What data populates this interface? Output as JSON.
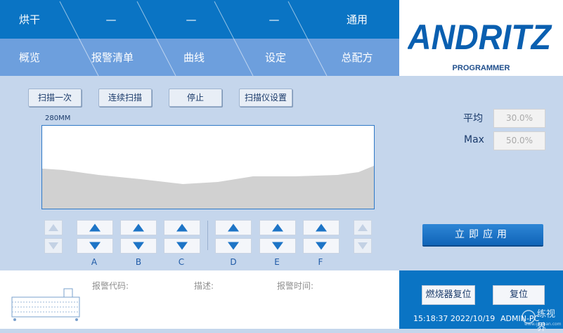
{
  "nav": {
    "row1": [
      "烘干",
      "—",
      "—",
      "—",
      "通用"
    ],
    "row2": [
      "概览",
      "报警清单",
      "曲线",
      "设定",
      "总配方"
    ]
  },
  "logo": {
    "brand": "ANDRITZ",
    "subtitle": "PROGRAMMER"
  },
  "scan_buttons": [
    "扫描一次",
    "连续扫描",
    "停止",
    "扫描仪设置"
  ],
  "chart": {
    "label": "280MM"
  },
  "stats": {
    "avg_label": "平均",
    "avg_value": "30.0%",
    "max_label": "Max",
    "max_value": "50.0%"
  },
  "channels": [
    "A",
    "B",
    "C",
    "D",
    "E",
    "F"
  ],
  "apply_label": "立即应用",
  "alarm": {
    "code_label": "报警代码:",
    "desc_label": "描述:",
    "time_label": "报警时间:"
  },
  "burner_reset_label": "燃烧器复位",
  "reset_label": "复位",
  "status": {
    "datetime": "15:18:37 2022/10/19",
    "user": "ADMIN-PC"
  },
  "watermark": {
    "text": "练视界",
    "url": "www.gkzhan.com"
  },
  "colors": {
    "nav_dark": "#0a74c4",
    "nav_light": "#6d9fdd",
    "panel_bg": "#c5d6ec",
    "arrow_blue": "#1d74c6"
  }
}
